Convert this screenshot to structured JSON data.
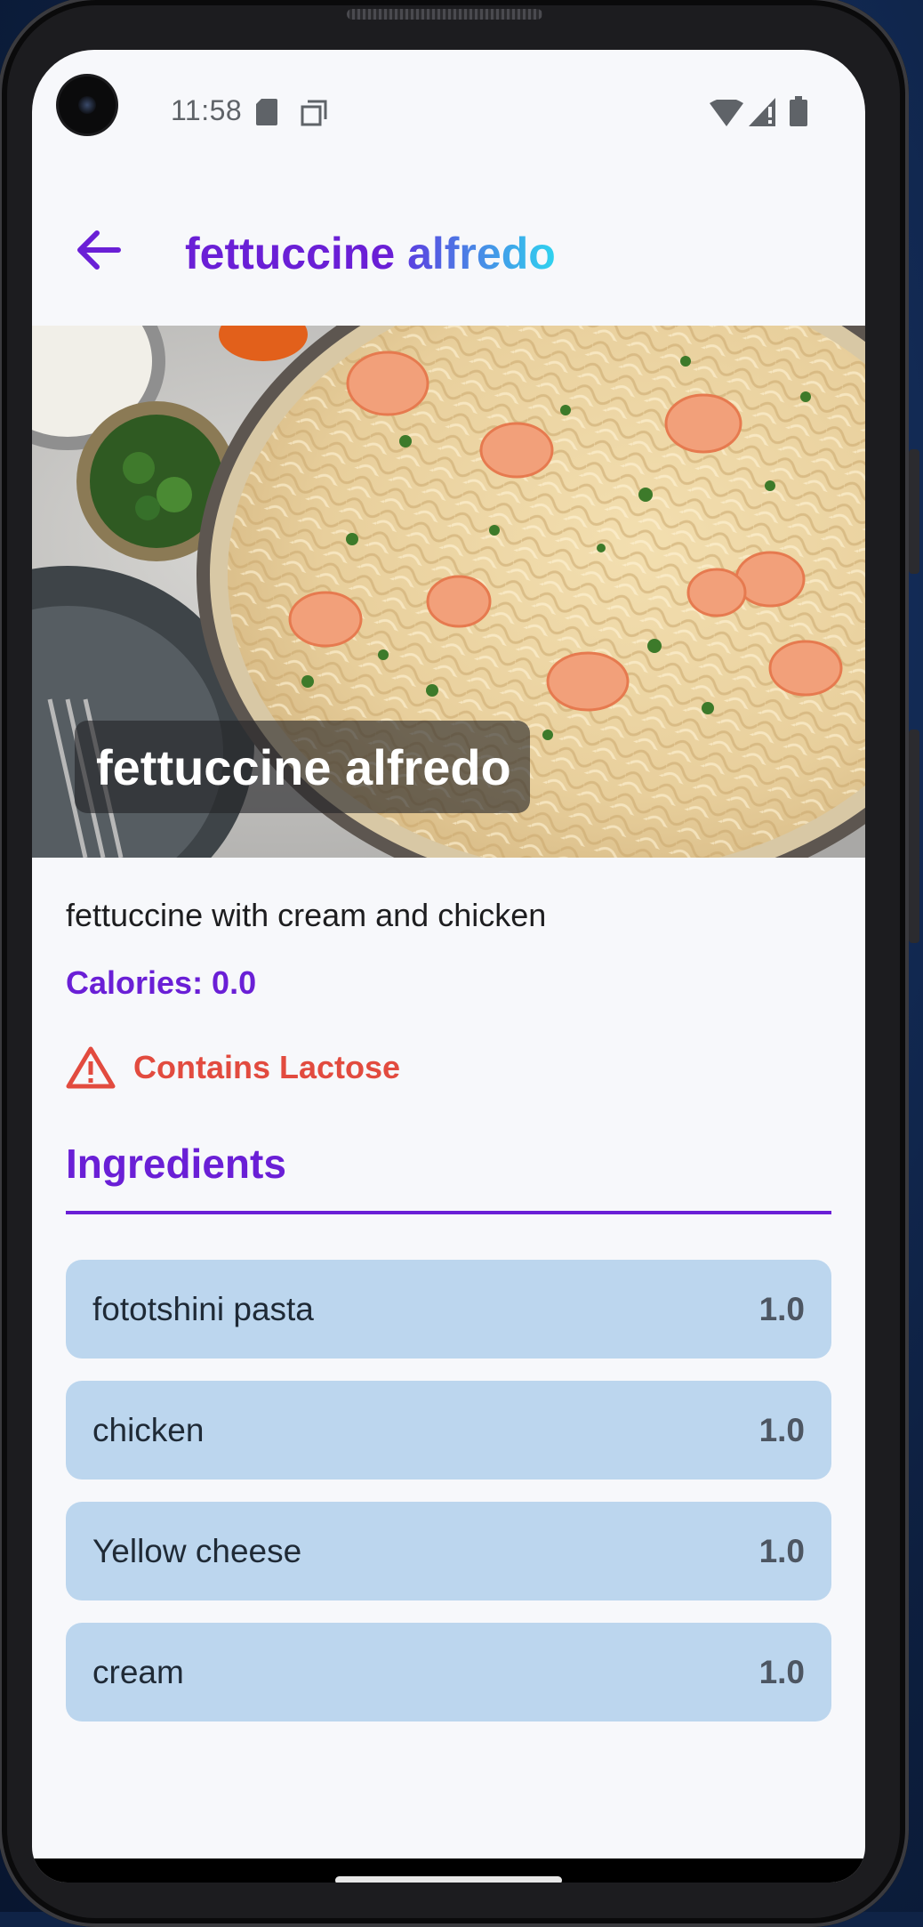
{
  "status_bar": {
    "time": "11:58",
    "icons": [
      "sd-card-icon",
      "screenshot-icon",
      "wifi-icon",
      "signal-icon",
      "battery-icon"
    ]
  },
  "app_bar": {
    "back_icon": "arrow-left-icon",
    "title_part1": "fettuccine",
    "title_part2": "alfredo"
  },
  "hero": {
    "overlay_title": "fettuccine alfredo"
  },
  "recipe": {
    "description": "fettuccine with cream and chicken",
    "calories": "Calories: 0.0",
    "warning_icon": "warning-triangle-icon",
    "warning_text": "Contains Lactose"
  },
  "ingredients": {
    "heading": "Ingredients",
    "items": [
      {
        "name": "fototshini pasta",
        "qty": "1.0"
      },
      {
        "name": "chicken",
        "qty": "1.0"
      },
      {
        "name": "Yellow cheese",
        "qty": "1.0"
      },
      {
        "name": "cream",
        "qty": "1.0"
      }
    ]
  },
  "colors": {
    "accent": "#6a1fd6",
    "warning": "#e24b3f",
    "ingredient_bg": "#bcd6ee",
    "screen_bg": "#f7f8fb"
  }
}
